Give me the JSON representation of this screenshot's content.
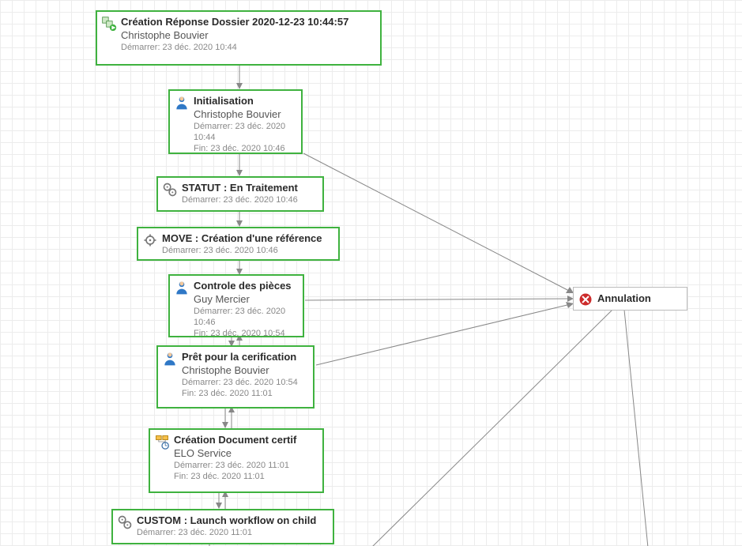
{
  "nodes": {
    "start": {
      "title": "Création Réponse Dossier 2020-12-23 10:44:57",
      "assignee": "Christophe Bouvier",
      "start": "Démarrer: 23 déc. 2020 10:44"
    },
    "init": {
      "title": "Initialisation",
      "assignee": "Christophe Bouvier",
      "start": "Démarrer: 23 déc. 2020 10:44",
      "end": "Fin: 23 déc. 2020 10:46"
    },
    "statut": {
      "title": "STATUT : En Traitement",
      "start": "Démarrer: 23 déc. 2020 10:46"
    },
    "move": {
      "title": "MOVE : Création d'une référence",
      "start": "Démarrer: 23 déc. 2020 10:46"
    },
    "controle": {
      "title": "Controle des pièces",
      "assignee": "Guy Mercier",
      "start": "Démarrer: 23 déc. 2020 10:46",
      "end": "Fin: 23 déc. 2020 10:54"
    },
    "pret": {
      "title": "Prêt pour la cerification",
      "assignee": "Christophe Bouvier",
      "start": "Démarrer: 23 déc. 2020 10:54",
      "end": "Fin: 23 déc. 2020 11:01"
    },
    "certif": {
      "title": "Création Document certif",
      "assignee": "ELO Service",
      "start": "Démarrer: 23 déc. 2020 11:01",
      "end": "Fin: 23 déc. 2020 11:01"
    },
    "custom": {
      "title": "CUSTOM : Launch workflow on child",
      "start": "Démarrer: 23 déc. 2020 11:01"
    },
    "annulation": {
      "title": "Annulation"
    }
  }
}
